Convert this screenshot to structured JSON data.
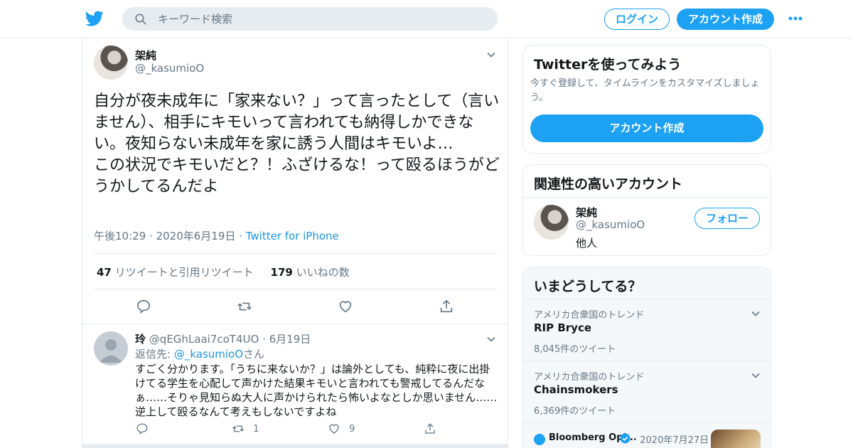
{
  "colors": {
    "accent": "#1da1f2",
    "link": "#1b95e0",
    "secondary_text": "#657786",
    "border": "#e6ecf0"
  },
  "header": {
    "logo_icon": "twitter-bird-icon",
    "search_placeholder": "キーワード検索",
    "login_label": "ログイン",
    "signup_label": "アカウント作成",
    "more_icon": "more-dots-icon"
  },
  "tweet": {
    "name": "架純",
    "handle": "@_kasumioO",
    "text": "自分が夜未成年に「家来ない？」って言ったとして（言いません）、相手にキモいって言われても納得しかできない。夜知らない未成年を家に誘う人間はキモいよ…\nこの状況でキモいだと？！ふざけるな！って殴るほうがどうかしてるんだよ",
    "time": "午後10:29",
    "date": "2020年6月19日",
    "source": "Twitter for iPhone",
    "retweet_count": "47",
    "retweet_label": "リツイートと引用リツイート",
    "like_count": "179",
    "like_label": "いいねの数"
  },
  "reply": {
    "name": "玲",
    "handle": "@qEGhLaai7coT4UO",
    "date": "6月19日",
    "replying_prefix": "返信先:",
    "replying_to": "@_kasumioO",
    "replying_suffix": "さん",
    "text": "すごく分かります。「うちに来ないか？」は論外としても、純粋に夜に出掛けてる学生を心配して声かけた結果キモいと言われても警戒してるんだなぁ……そりゃ見知らぬ大人に声かけられたら怖いよなとしか思いません……逆上して殴るなんて考えもしないですよね",
    "retweets": "1",
    "likes": "9"
  },
  "signup_card": {
    "title": "Twitterを使ってみよう",
    "subtitle": "今すぐ登録して、タイムラインをカスタマイズしましょう。",
    "button": "アカウント作成"
  },
  "related_card": {
    "title": "関連性の高いアカウント",
    "name": "架純",
    "handle": "@_kasumioO",
    "bio": "他人",
    "follow_label": "フォロー"
  },
  "trends_card": {
    "title": "いまどうしてる？",
    "trends": [
      {
        "context": "アメリカ合衆国のトレンド",
        "name": "RIP Bryce",
        "count": "8,045件のツイート"
      },
      {
        "context": "アメリカ合衆国のトレンド",
        "name": "Chainsmokers",
        "count": "6,369件のツイート"
      }
    ],
    "news_source": "Bloomberg Opi...",
    "news_date": "2020年7月27日"
  }
}
